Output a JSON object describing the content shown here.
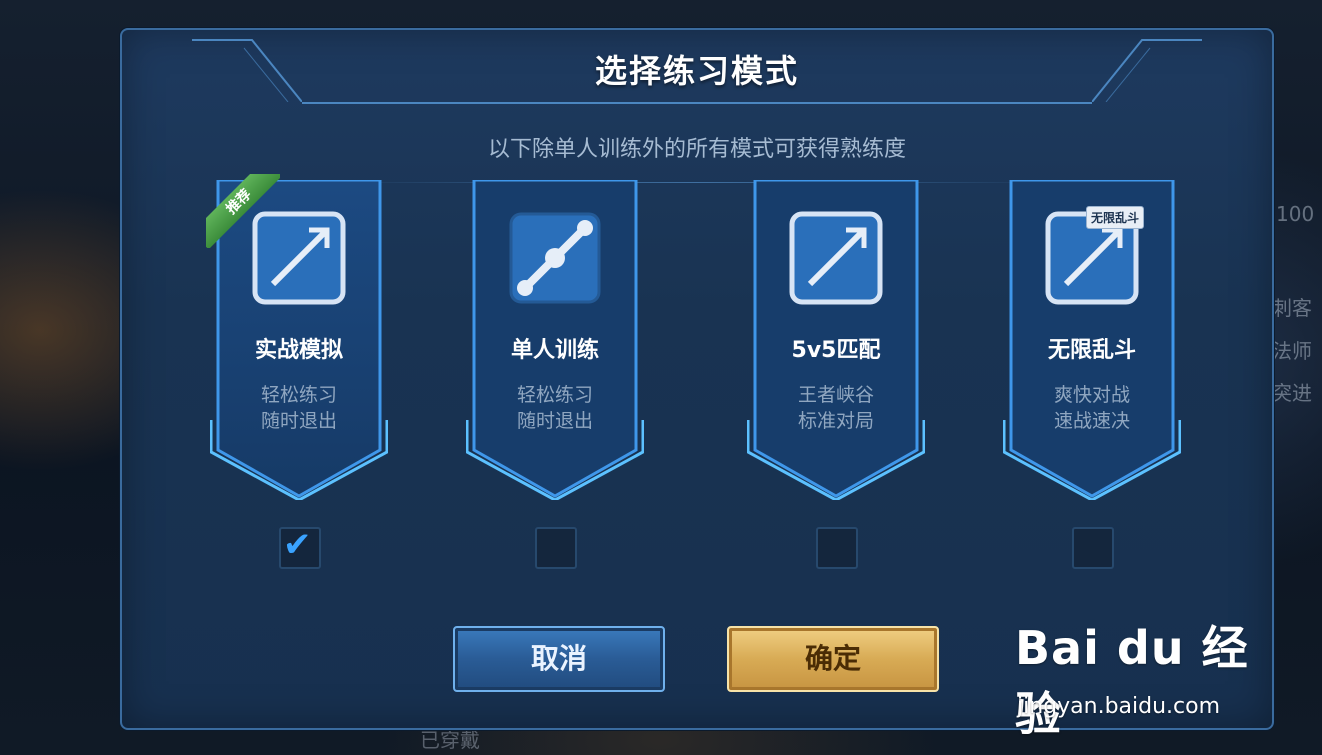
{
  "dialog": {
    "title": "选择练习模式",
    "subtitle": "以下除单人训练外的所有模式可获得熟练度"
  },
  "modes": [
    {
      "title": "实战模拟",
      "desc1": "轻松练习",
      "desc2": "随时退出",
      "badge": "推荐",
      "checked": true,
      "icon": "arrow-icon"
    },
    {
      "title": "单人训练",
      "desc1": "轻松练习",
      "desc2": "随时退出",
      "checked": false,
      "icon": "dumbbell-icon"
    },
    {
      "title": "5v5匹配",
      "desc1": "王者峡谷",
      "desc2": "标准对局",
      "checked": false,
      "icon": "arrow-icon"
    },
    {
      "title": "无限乱斗",
      "desc1": "爽快对战",
      "desc2": "速战速决",
      "tag": "无限乱斗",
      "checked": false,
      "icon": "arrow-icon"
    }
  ],
  "buttons": {
    "cancel": "取消",
    "confirm": "确定"
  },
  "background": {
    "right_labels": [
      "100",
      "刺客",
      "法师",
      "突进"
    ],
    "bottom_label": "已穿戴"
  },
  "watermark": {
    "logo": "Bai du 经验",
    "url": "jingyan.baidu.com"
  },
  "colors": {
    "accent_blue": "#3aa3ff",
    "confirm_gold": "#d8ab55",
    "dialog_bg": "#1e3a5f",
    "badge_green": "#4ea24b"
  }
}
